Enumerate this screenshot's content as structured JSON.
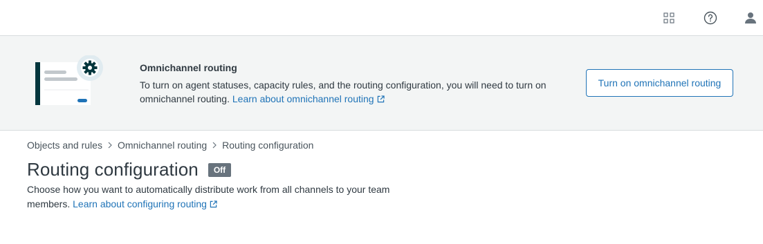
{
  "topbar": {
    "icons": [
      "apps-grid-icon",
      "help-icon",
      "user-icon"
    ]
  },
  "banner": {
    "title": "Omnichannel routing",
    "text": "To turn on agent statuses, capacity rules, and the routing configuration, you will need to turn on omnichannel routing.",
    "link_label": "Learn about omnichannel routing",
    "button_label": "Turn on omnichannel routing"
  },
  "breadcrumb": {
    "items": [
      "Objects and rules",
      "Omnichannel routing",
      "Routing configuration"
    ]
  },
  "page": {
    "title": "Routing configuration",
    "status": "Off",
    "description": "Choose how you want to automatically distribute work from all channels to your team members.",
    "link_label": "Learn about configuring routing"
  },
  "colors": {
    "link": "#1f73b7",
    "banner_bg": "#f3f5f5",
    "badge_bg": "#68737d",
    "illustration_accent": "#03363d"
  }
}
